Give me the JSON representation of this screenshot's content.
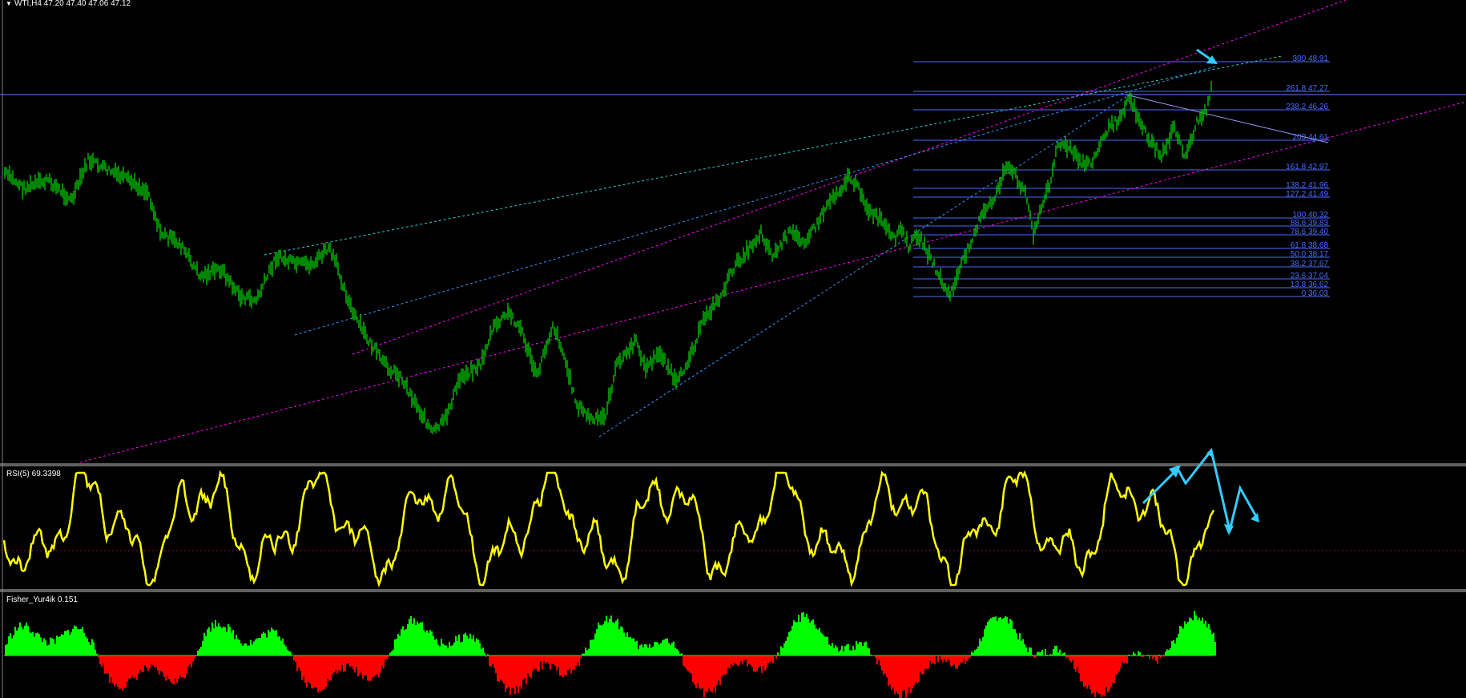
{
  "main": {
    "corner_icon": "triangle-down-icon",
    "header": "WTI,H4  47.20 47.40 47.06 47.12"
  },
  "rsi": {
    "label": "RSI(5) 69.3398"
  },
  "fisher": {
    "label": "Fisher_Yur4ik 0.151"
  },
  "fib_levels": [
    "300 48.91",
    "261.8 47.27",
    "238.2 46.26",
    "200 44.61",
    "161.8 42.97",
    "138.2 41.96",
    "127.2 41.49",
    "100 40.32",
    "88.6 39.83",
    "78.6 39.40",
    "61.8 38.68",
    "50.0 38.17",
    "38.2 37.67",
    "23.6 37.04",
    "13.8 36.62",
    "0 36.03"
  ],
  "colors": {
    "background": "#000000",
    "candles": "#00c000",
    "rsi_line": "#ffff00",
    "fisher_positive": "#00ff00",
    "fisher_negative": "#ff0000",
    "fib_lines": "#4a6bff",
    "channel_magenta": "#ff00ff",
    "channel_blue": "#3399ff",
    "annotation_arrows": "#33ccff",
    "separator": "#c0c0c0"
  }
}
